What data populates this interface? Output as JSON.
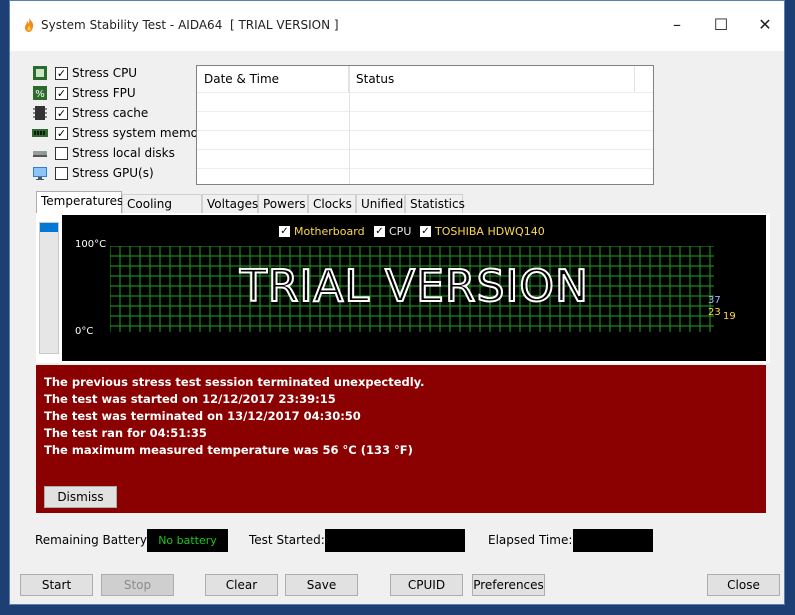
{
  "window": {
    "title": "System Stability Test - AIDA64  [ TRIAL VERSION ]"
  },
  "stress_options": [
    {
      "label": "Stress CPU",
      "checked": true,
      "icon": "cpu-icon"
    },
    {
      "label": "Stress FPU",
      "checked": true,
      "icon": "fpu-icon"
    },
    {
      "label": "Stress cache",
      "checked": true,
      "icon": "cache-icon"
    },
    {
      "label": "Stress system memory",
      "checked": true,
      "icon": "memory-icon"
    },
    {
      "label": "Stress local disks",
      "checked": false,
      "icon": "disk-icon"
    },
    {
      "label": "Stress GPU(s)",
      "checked": false,
      "icon": "gpu-icon"
    }
  ],
  "log_table": {
    "columns": [
      "Date & Time",
      "Status"
    ]
  },
  "tabs": [
    "Temperatures",
    "Cooling Fans",
    "Voltages",
    "Powers",
    "Clocks",
    "Unified",
    "Statistics"
  ],
  "graph": {
    "legend": [
      {
        "label": "Motherboard",
        "checked": true,
        "color": "#ffd84a"
      },
      {
        "label": "CPU",
        "checked": true,
        "color": "#e8e8e8"
      },
      {
        "label": "TOSHIBA HDWQ140",
        "checked": true,
        "color": "#ffd84a"
      }
    ],
    "y_max_label": "100°C",
    "y_min_label": "0°C",
    "watermark": "TRIAL VERSION",
    "readouts": [
      {
        "value": "37",
        "color": "#a8b8ff"
      },
      {
        "value": "23",
        "color": "#ffd84a"
      },
      {
        "value": "19",
        "color": "#ffd84a"
      }
    ],
    "grid_color": "#1fa31f"
  },
  "alert": {
    "lines": [
      "The previous stress test session terminated unexpectedly.",
      "The test was started on 12/12/2017 23:39:15",
      "The test was terminated on 13/12/2017 04:30:50",
      "The test ran for 04:51:35",
      "The maximum measured temperature was 56 °C  (133 °F)"
    ],
    "dismiss_label": "Dismiss",
    "background": "#8b0000"
  },
  "status": {
    "battery_label": "Remaining Battery:",
    "battery_value": "No battery",
    "started_label": "Test Started:",
    "started_value": "",
    "elapsed_label": "Elapsed Time:",
    "elapsed_value": ""
  },
  "buttons": {
    "start": "Start",
    "stop": "Stop",
    "clear": "Clear",
    "save": "Save",
    "cpuid": "CPUID",
    "preferences": "Preferences",
    "close": "Close"
  }
}
